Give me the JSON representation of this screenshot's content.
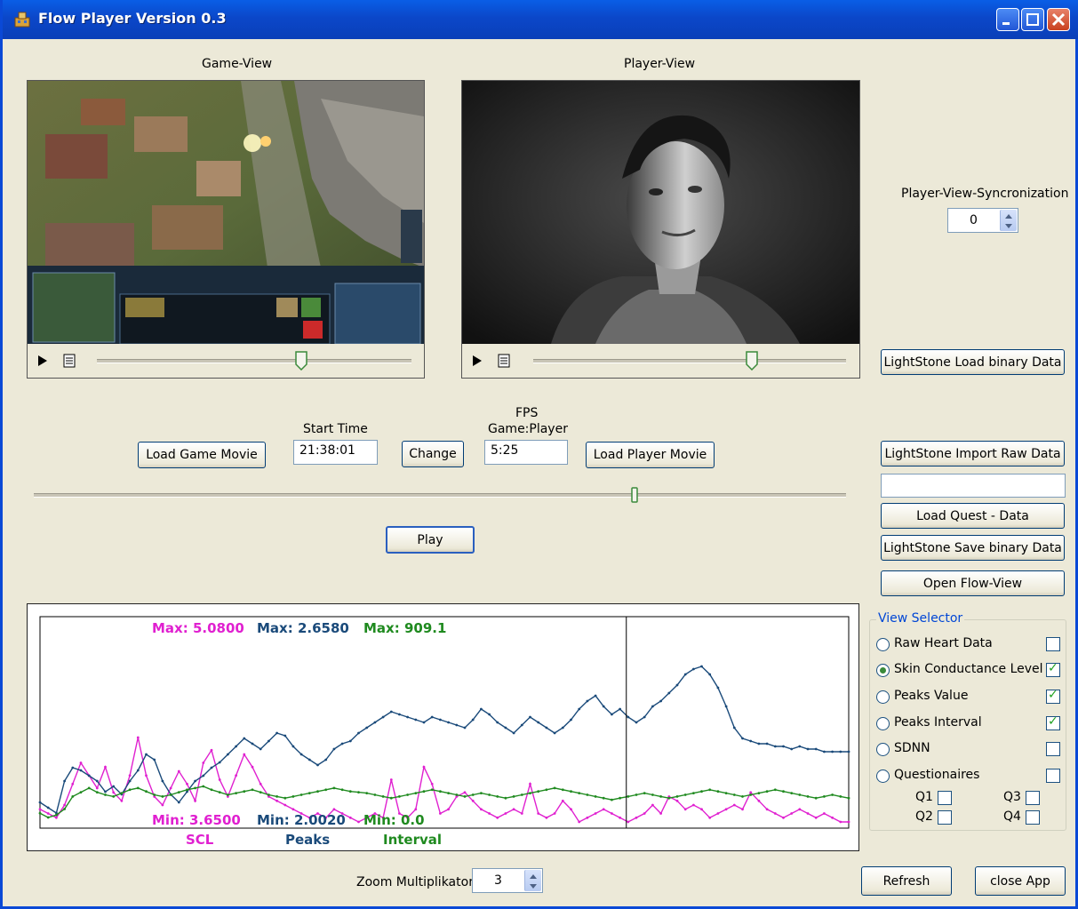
{
  "window": {
    "title": "Flow Player Version 0.3"
  },
  "game_view": {
    "label": "Game-View",
    "slider_value": 0.65
  },
  "player_view": {
    "label": "Player-View",
    "slider_value": 0.7
  },
  "sync": {
    "label": "Player-View-Syncronization",
    "value": "0"
  },
  "buttons": {
    "lightstone_load": "LightStone Load binary Data",
    "load_game_movie": "Load Game Movie",
    "change": "Change",
    "load_player_movie": "Load Player Movie",
    "lightstone_import": "LightStone Import Raw Data",
    "load_quest": "Load Quest - Data",
    "lightstone_save": "LightStone Save binary Data",
    "open_flow_view": "Open Flow-View",
    "play": "Play",
    "refresh": "Refresh",
    "close_app": "close App"
  },
  "start_time": {
    "label": "Start Time",
    "value": "21:38:01"
  },
  "fps": {
    "label_line1": "FPS",
    "label_line2": "Game:Player",
    "value": "5:25"
  },
  "import_path": {
    "value": ""
  },
  "main_slider": {
    "value": 0.74
  },
  "view_selector": {
    "title": "View Selector",
    "items": [
      {
        "label": "Raw Heart Data",
        "selected": false,
        "checked": false
      },
      {
        "label": "Skin Conductance Level",
        "selected": true,
        "checked": true
      },
      {
        "label": "Peaks Value",
        "selected": false,
        "checked": true
      },
      {
        "label": "Peaks Interval",
        "selected": false,
        "checked": true
      },
      {
        "label": "SDNN",
        "selected": false,
        "checked": false
      },
      {
        "label": "Questionaires",
        "selected": false,
        "checked": false
      }
    ],
    "questions": [
      {
        "label": "Q1",
        "checked": false
      },
      {
        "label": "Q3",
        "checked": false
      },
      {
        "label": "Q2",
        "checked": false
      },
      {
        "label": "Q4",
        "checked": false
      }
    ]
  },
  "zoom": {
    "label": "Zoom Multiplikator",
    "value": "3"
  },
  "colors": {
    "scl": "#e020d0",
    "peaks": "#1a4a7a",
    "interval": "#1f8a1f",
    "titlebar": "#0a5ee6",
    "window_bg": "#ece9d8"
  },
  "chart_data": {
    "type": "line",
    "cursor_x": 0.725,
    "series": [
      {
        "name": "SCL",
        "max_label": "Max: 5.0800",
        "min_label": "Min: 3.6500",
        "max": 5.08,
        "min": 3.65,
        "values": [
          3.9,
          3.85,
          3.8,
          3.95,
          4.2,
          4.45,
          4.3,
          4.15,
          4.4,
          4.1,
          4.0,
          4.3,
          4.75,
          4.3,
          4.05,
          3.95,
          4.15,
          4.35,
          4.2,
          4.0,
          4.45,
          4.6,
          4.25,
          4.05,
          4.3,
          4.55,
          4.4,
          4.2,
          4.05,
          4.0,
          3.95,
          3.9,
          3.85,
          3.8,
          3.85,
          3.8,
          3.9,
          3.85,
          3.8,
          3.75,
          3.8,
          3.85,
          3.8,
          4.25,
          3.85,
          3.8,
          3.9,
          4.4,
          4.2,
          3.85,
          3.9,
          4.05,
          4.1,
          4.0,
          3.9,
          3.85,
          3.8,
          3.85,
          3.9,
          3.85,
          4.2,
          3.85,
          3.8,
          3.85,
          4.0,
          3.9,
          3.75,
          3.8,
          3.85,
          3.9,
          3.85,
          3.8,
          3.75,
          3.8,
          3.85,
          3.95,
          3.85,
          4.05,
          4.0,
          3.9,
          3.95,
          3.9,
          3.8,
          3.85,
          3.9,
          3.95,
          3.9,
          4.1,
          4.0,
          3.9,
          3.85,
          3.8,
          3.85,
          3.9,
          3.85,
          3.8,
          3.85,
          3.8,
          3.75,
          3.75
        ]
      },
      {
        "name": "Peaks",
        "max_label": "Max: 2.6580",
        "min_label": "Min: 2.0020",
        "max": 2.658,
        "min": 2.002,
        "values": [
          2.12,
          2.1,
          2.08,
          2.2,
          2.25,
          2.24,
          2.22,
          2.2,
          2.16,
          2.18,
          2.15,
          2.2,
          2.24,
          2.3,
          2.28,
          2.2,
          2.15,
          2.12,
          2.16,
          2.2,
          2.22,
          2.25,
          2.27,
          2.3,
          2.33,
          2.36,
          2.34,
          2.32,
          2.35,
          2.38,
          2.37,
          2.33,
          2.3,
          2.28,
          2.26,
          2.28,
          2.32,
          2.34,
          2.35,
          2.38,
          2.4,
          2.42,
          2.44,
          2.46,
          2.45,
          2.44,
          2.43,
          2.42,
          2.44,
          2.43,
          2.42,
          2.41,
          2.4,
          2.43,
          2.47,
          2.45,
          2.42,
          2.4,
          2.38,
          2.41,
          2.44,
          2.42,
          2.4,
          2.38,
          2.4,
          2.43,
          2.47,
          2.5,
          2.52,
          2.48,
          2.45,
          2.47,
          2.44,
          2.42,
          2.44,
          2.48,
          2.5,
          2.53,
          2.56,
          2.6,
          2.62,
          2.63,
          2.6,
          2.55,
          2.48,
          2.4,
          2.36,
          2.35,
          2.34,
          2.34,
          2.33,
          2.33,
          2.32,
          2.33,
          2.32,
          2.32,
          2.31,
          2.31,
          2.31,
          2.31
        ]
      },
      {
        "name": "Interval",
        "max_label": "Max: 909.1",
        "min_label": "Min: 0.0",
        "max": 909.1,
        "min": 0.0,
        "values": [
          60,
          55,
          58,
          65,
          80,
          85,
          90,
          85,
          82,
          80,
          84,
          88,
          90,
          86,
          82,
          80,
          82,
          85,
          88,
          90,
          92,
          88,
          85,
          82,
          84,
          86,
          88,
          85,
          82,
          80,
          78,
          80,
          82,
          84,
          86,
          88,
          90,
          88,
          86,
          85,
          84,
          82,
          80,
          78,
          80,
          82,
          84,
          86,
          88,
          86,
          84,
          82,
          80,
          82,
          84,
          82,
          80,
          78,
          80,
          82,
          84,
          86,
          88,
          90,
          88,
          86,
          84,
          82,
          80,
          78,
          76,
          78,
          80,
          82,
          84,
          82,
          80,
          78,
          80,
          82,
          84,
          86,
          88,
          86,
          84,
          82,
          80,
          82,
          84,
          86,
          88,
          86,
          84,
          82,
          80,
          78,
          80,
          82,
          80,
          78
        ]
      }
    ],
    "legend": [
      "SCL",
      "Peaks",
      "Interval"
    ]
  }
}
